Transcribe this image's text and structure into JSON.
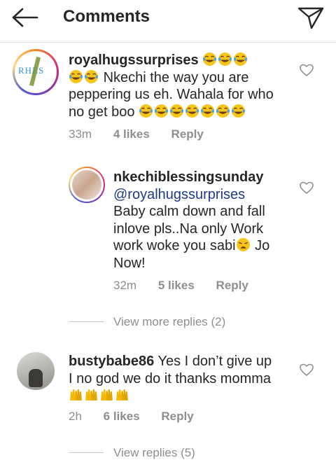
{
  "header": {
    "title": "Comments"
  },
  "comments": [
    {
      "username": "royalhugssurprises",
      "avatar_text": "RHES",
      "text_line1_suffix": "",
      "text_line2": "Nkechi the way you are",
      "text_line3": "peppering us eh. Wahala for who",
      "text_line4": "no get boo",
      "time": "33m",
      "likes": "4 likes",
      "reply": "Reply"
    },
    {
      "username": "nkechiblessingsunday",
      "mention": "@royalhugssurprises",
      "text_line1": "Baby calm down and fall",
      "text_line2": "inlove pls..Na only Work",
      "text_line3": "work woke you sabi",
      "text_line3_tail": " Jo",
      "text_line4": "Now!",
      "time": "32m",
      "likes": "5 likes",
      "reply": "Reply"
    },
    {
      "username": "bustybabe86",
      "text_line1": " Yes I don’t give up",
      "text_line2": "I no god we do it thanks momma",
      "time": "2h",
      "likes": "6 likes",
      "reply": "Reply"
    }
  ],
  "view_more_replies": "View more replies (2)",
  "view_replies": "View replies (5)",
  "colors": {
    "emoji": "#f5c518",
    "hands": "#f5b800",
    "heart_stroke": "#8e8e8e"
  }
}
